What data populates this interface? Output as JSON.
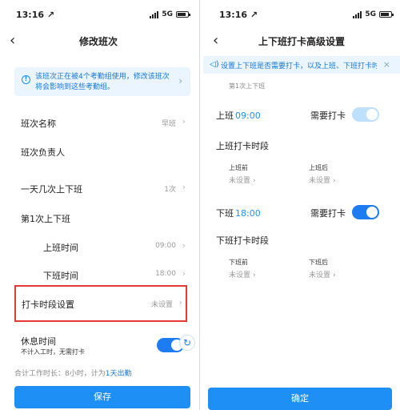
{
  "left": {
    "status": {
      "time": "13:16 ↗",
      "network": "5G"
    },
    "nav_title": "修改班次",
    "notice": "该班次正在被4个考勤组使用，修改该班次将会影响到这些考勤组。",
    "rows": [
      {
        "label": "班次名称",
        "value": "早班"
      },
      {
        "label": "班次负责人",
        "value": ""
      },
      {
        "label": "一天几次上下班",
        "value": "1次"
      },
      {
        "label": "第1次上下班",
        "value": ""
      },
      {
        "label": "上班时间",
        "value": "09:00"
      },
      {
        "label": "下班时间",
        "value": "18:00"
      }
    ],
    "punch_setting": {
      "label": "打卡时段设置",
      "value": "未设置"
    },
    "rest": {
      "label": "休息时间",
      "sub": "不计入工时，无需打卡",
      "enabled": true
    },
    "total": {
      "prefix": "合计工作时长：8小时，计为",
      "highlight": "1天出勤"
    },
    "save_label": "保存"
  },
  "right": {
    "status": {
      "time": "13:16 ↗",
      "network": "5G"
    },
    "nav_title": "上下班打卡高级设置",
    "tip": "设置上下班是否需要打卡，以及上班、下班打卡时段",
    "section": "第1次上下班",
    "on_duty": {
      "label": "上班",
      "time": "09:00",
      "need_label": "需要打卡",
      "enabled": true
    },
    "on_period": {
      "title": "上班打卡时段",
      "before_label": "上班前",
      "before_value": "未设置",
      "after_label": "上班后",
      "after_value": "未设置"
    },
    "off_duty": {
      "label": "下班",
      "time": "18:00",
      "need_label": "需要打卡",
      "enabled": true
    },
    "off_period": {
      "title": "下班打卡时段",
      "before_label": "下班前",
      "before_value": "未设置",
      "after_label": "下班后",
      "after_value": "未设置"
    },
    "confirm_label": "确定"
  },
  "colors": {
    "accent": "#1e8ff5",
    "highlight_border": "#e53935",
    "notice_bg": "#eaf5ff"
  }
}
